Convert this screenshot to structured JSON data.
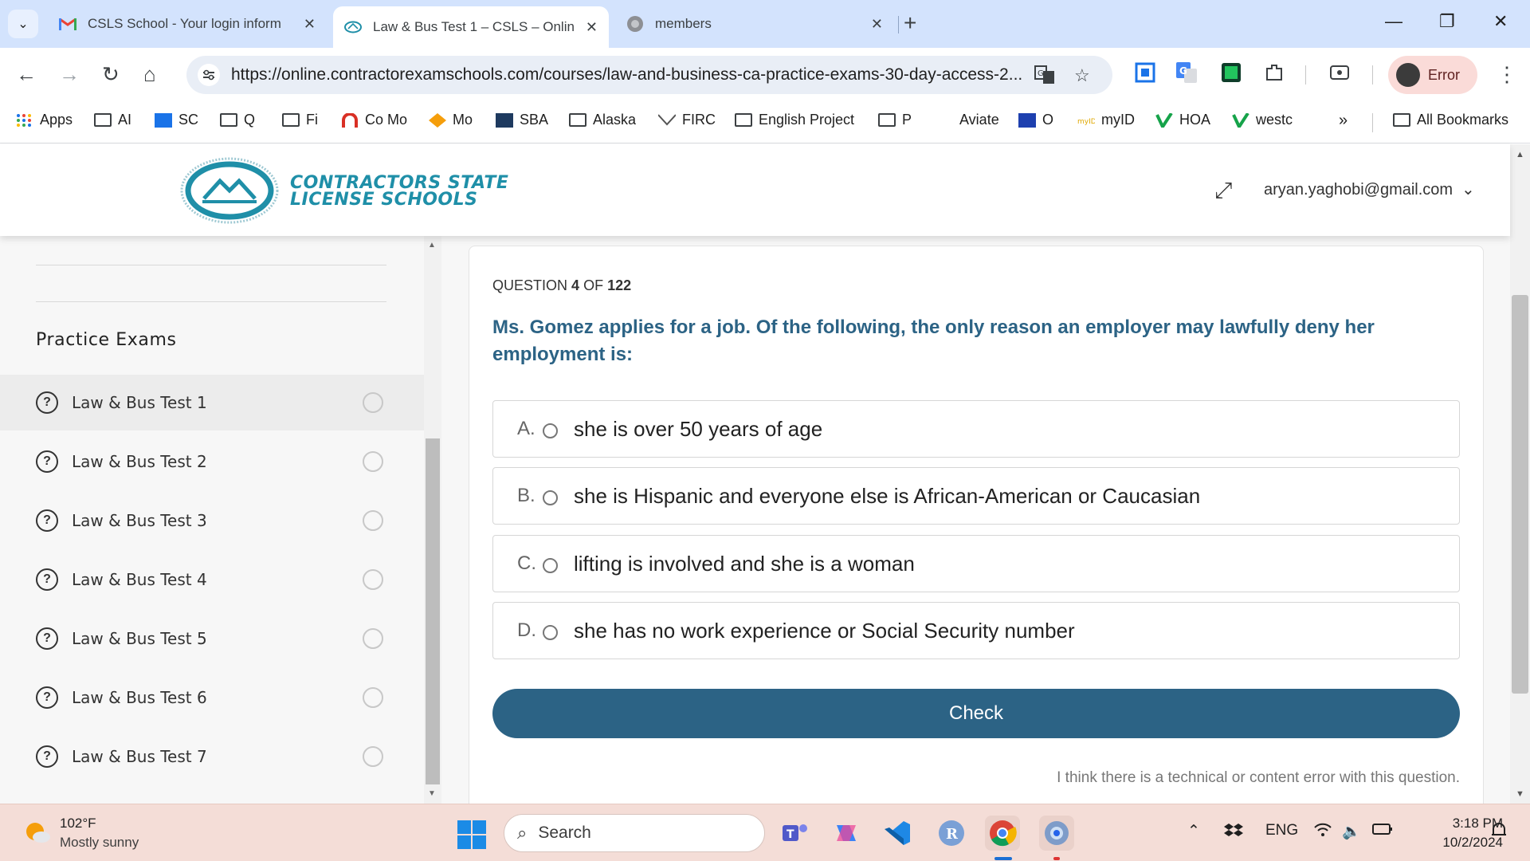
{
  "browser": {
    "tabs": [
      {
        "title": "CSLS School - Your login inform"
      },
      {
        "title": "Law & Bus Test 1 – CSLS – Onlin"
      },
      {
        "title": "members"
      }
    ],
    "url": "https://online.contractorexamschools.com/courses/law-and-business-ca-practice-exams-30-day-access-2...",
    "profile_label": "Error",
    "bookmarks": [
      "Apps",
      "AI",
      "SC",
      "Q",
      "Fi",
      "Co Mo",
      "Mo",
      "SBA",
      "Alaska",
      "FIRC",
      "English Project",
      "P",
      "Aviate",
      "O",
      "myID",
      "HOA",
      "westc"
    ],
    "bookmarks_overflow": "»",
    "all_bookmarks": "All Bookmarks"
  },
  "site": {
    "logo_line1": "CONTRACTORS STATE",
    "logo_line2": "LICENSE SCHOOLS",
    "user_email": "aryan.yaghobi@gmail.com"
  },
  "sidebar": {
    "section_title": "Practice Exams",
    "lessons": [
      {
        "label": "Law & Bus Test 1"
      },
      {
        "label": "Law & Bus Test 2"
      },
      {
        "label": "Law & Bus Test 3"
      },
      {
        "label": "Law & Bus Test 4"
      },
      {
        "label": "Law & Bus Test 5"
      },
      {
        "label": "Law & Bus Test 6"
      },
      {
        "label": "Law & Bus Test 7"
      }
    ]
  },
  "quiz": {
    "counter_prefix": "QUESTION",
    "current": "4",
    "counter_of": "OF",
    "total": "122",
    "question": "Ms. Gomez applies for a job. Of the following, the only reason an employer may lawfully deny her employment is:",
    "answers": [
      {
        "letter": "A.",
        "text": "she is over 50 years of age"
      },
      {
        "letter": "B.",
        "text": "she is Hispanic and everyone else is African-American or Caucasian"
      },
      {
        "letter": "C.",
        "text": "lifting is involved and she is a woman"
      },
      {
        "letter": "D.",
        "text": "she has no work experience or Social Security number"
      }
    ],
    "check_label": "Check",
    "report_text": "I think there is a technical or content error with this question."
  },
  "taskbar": {
    "temperature": "102°F",
    "weather": "Mostly sunny",
    "search_placeholder": "Search",
    "language": "ENG",
    "time": "3:18 PM",
    "date": "10/2/2024"
  },
  "colors": {
    "brand_blue": "#2c6385",
    "logo_teal": "#1f8fa8",
    "tab_strip": "#d3e3fd"
  }
}
